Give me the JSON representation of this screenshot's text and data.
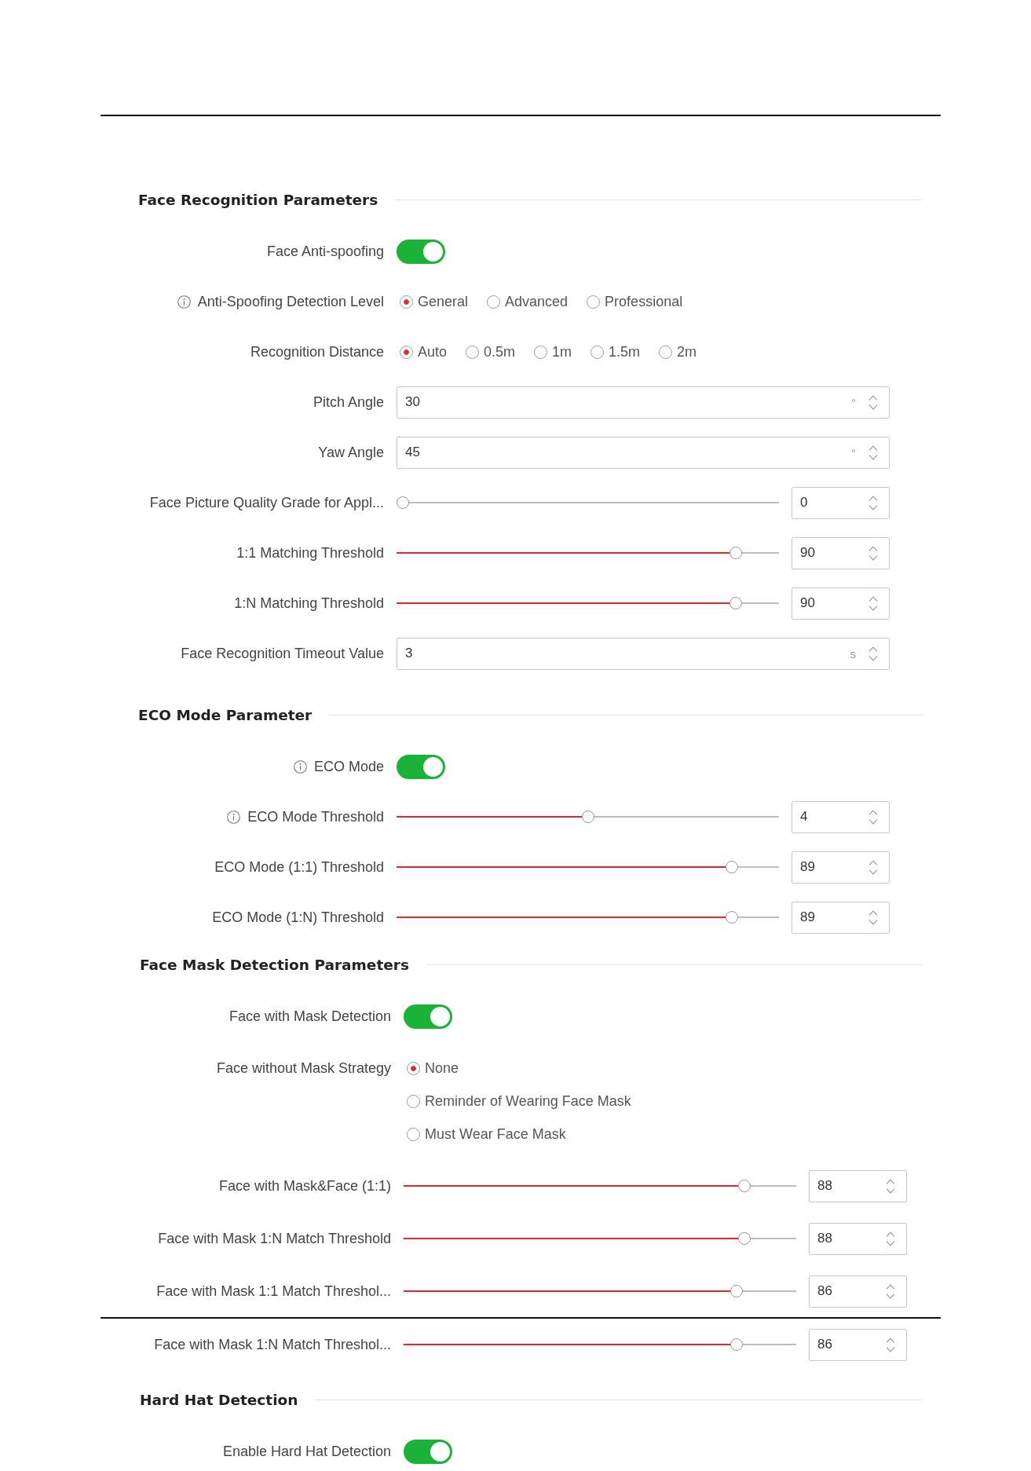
{
  "sections": [
    {
      "title": "Face Recognition Parameters",
      "rows": [
        {
          "kind": "toggle",
          "label": "Face Anti-spoofing",
          "on": true
        },
        {
          "kind": "radio",
          "label": "Anti-Spoofing Detection Level",
          "info": true,
          "options": [
            {
              "label": "General",
              "selected": true
            },
            {
              "label": "Advanced",
              "selected": false
            },
            {
              "label": "Professional",
              "selected": false
            }
          ]
        },
        {
          "kind": "radio",
          "label": "Recognition Distance",
          "options": [
            {
              "label": "Auto",
              "selected": true
            },
            {
              "label": "0.5m",
              "selected": false
            },
            {
              "label": "1m",
              "selected": false
            },
            {
              "label": "1.5m",
              "selected": false
            },
            {
              "label": "2m",
              "selected": false
            }
          ]
        },
        {
          "kind": "number",
          "label": "Pitch Angle",
          "value": "30",
          "unit": "°"
        },
        {
          "kind": "number",
          "label": "Yaw Angle",
          "value": "45",
          "unit": "°"
        },
        {
          "kind": "slider",
          "label": "Face Picture Quality Grade for Appl...",
          "level": 0,
          "value": "0"
        },
        {
          "kind": "slider",
          "label": "1:1 Matching Threshold",
          "level": 0.9,
          "value": "90"
        },
        {
          "kind": "slider",
          "label": "1:N Matching Threshold",
          "level": 0.9,
          "value": "90"
        },
        {
          "kind": "number",
          "label": "Face Recognition Timeout Value",
          "value": "3",
          "unit": "s"
        }
      ]
    },
    {
      "title": "ECO Mode Parameter",
      "rows": [
        {
          "kind": "toggle",
          "label": "ECO Mode",
          "info": true,
          "on": true
        },
        {
          "kind": "slider",
          "label": "ECO Mode Threshold",
          "info": true,
          "level": 0.5,
          "value": "4"
        },
        {
          "kind": "slider",
          "label": "ECO Mode (1:1) Threshold",
          "level": 0.89,
          "value": "89"
        },
        {
          "kind": "slider",
          "label": "ECO Mode (1:N) Threshold",
          "level": 0.89,
          "value": "89"
        }
      ]
    },
    {
      "title": "Face Mask Detection Parameters",
      "rows": [
        {
          "kind": "toggle",
          "label": "Face with Mask Detection",
          "on": true
        },
        {
          "kind": "radio-list",
          "label": "Face without Mask Strategy",
          "options": [
            {
              "label": "None",
              "selected": true
            },
            {
              "label": "Reminder of Wearing Face Mask",
              "selected": false
            },
            {
              "label": "Must Wear Face Mask",
              "selected": false
            }
          ]
        },
        {
          "kind": "slider",
          "label": "Face with Mask&Face (1:1)",
          "level": 0.88,
          "value": "88"
        },
        {
          "kind": "slider",
          "label": "Face with Mask 1:N Match Threshold",
          "level": 0.88,
          "value": "88"
        },
        {
          "kind": "slider",
          "label": "Face with Mask 1:1 Match Threshol...",
          "level": 0.86,
          "value": "86"
        },
        {
          "kind": "slider",
          "label": "Face with Mask 1:N Match Threshol...",
          "level": 0.86,
          "value": "86",
          "page_break_before": true
        }
      ]
    },
    {
      "title": "Hard Hat Detection",
      "rows": [
        {
          "kind": "toggle",
          "label": "Enable Hard Hat Detection",
          "on": true
        }
      ]
    }
  ]
}
